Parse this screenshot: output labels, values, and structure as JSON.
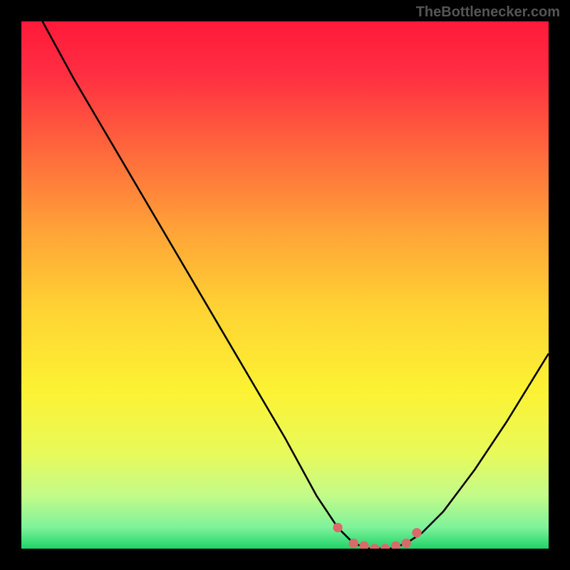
{
  "watermark": "TheBottlenecker.com",
  "chart_data": {
    "type": "line",
    "title": "",
    "xlabel": "",
    "ylabel": "",
    "xlim": [
      0,
      100
    ],
    "ylim": [
      0,
      100
    ],
    "series": [
      {
        "name": "bottleneck-curve",
        "x": [
          4,
          10,
          20,
          30,
          40,
          50,
          56,
          60,
          63,
          66,
          70,
          73,
          76,
          80,
          86,
          92,
          100
        ],
        "values": [
          100,
          89,
          72,
          55,
          38,
          21,
          10,
          4,
          1,
          0,
          0,
          1,
          3,
          7,
          15,
          24,
          37
        ]
      }
    ],
    "markers": {
      "name": "highlight-dots",
      "color": "#d86a6a",
      "x": [
        60,
        63,
        65,
        67,
        69,
        71,
        73,
        75
      ],
      "values": [
        4,
        1,
        0.5,
        0,
        0,
        0.5,
        1,
        3
      ]
    },
    "gradient_stops": [
      {
        "offset": 0.0,
        "color": "#ff1a3a"
      },
      {
        "offset": 0.1,
        "color": "#ff2e42"
      },
      {
        "offset": 0.25,
        "color": "#ff6a3c"
      },
      {
        "offset": 0.4,
        "color": "#ffa437"
      },
      {
        "offset": 0.55,
        "color": "#ffd433"
      },
      {
        "offset": 0.7,
        "color": "#fcf233"
      },
      {
        "offset": 0.82,
        "color": "#e8fa5a"
      },
      {
        "offset": 0.9,
        "color": "#c2fb8a"
      },
      {
        "offset": 0.96,
        "color": "#7ef29a"
      },
      {
        "offset": 1.0,
        "color": "#1fd46a"
      }
    ]
  }
}
